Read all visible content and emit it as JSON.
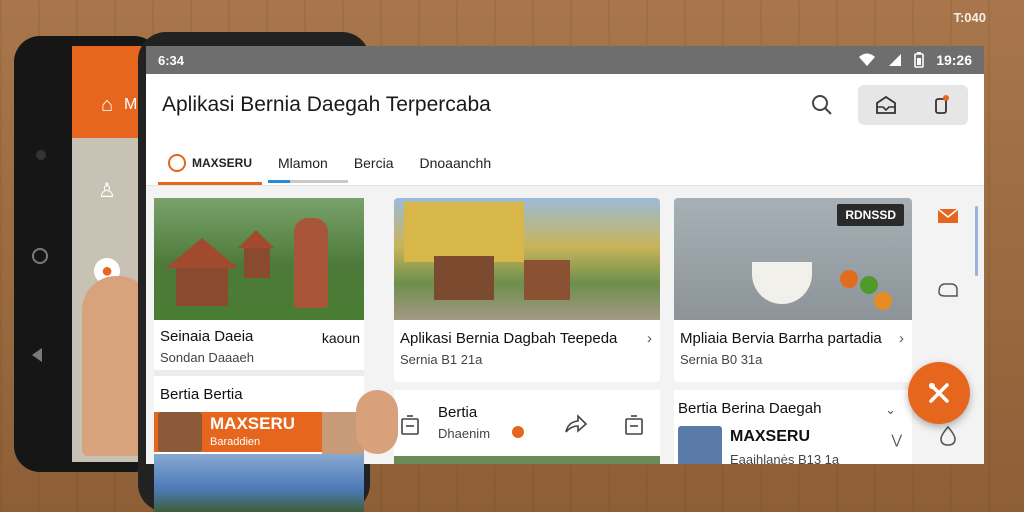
{
  "corner_stamp": "T:040",
  "status": {
    "left_text": "6:34",
    "time": "19:26"
  },
  "app": {
    "title": "Aplikasi Bernia Daegah Terpercaba"
  },
  "tabs": [
    {
      "label": "MAXSERU"
    },
    {
      "label": "Mlamon"
    },
    {
      "label": "Bercia"
    },
    {
      "label": "Dnoaanchh"
    }
  ],
  "back_phone": {
    "label": "M"
  },
  "cards": [
    {
      "title": "Seinaia Daeia",
      "aside": "kaoun",
      "sub": "Sondan Daaaeh"
    },
    {
      "title": "Aplikasi Bernia Dagbah Teepeda",
      "sub": "Sernia B1 21a"
    },
    {
      "title": "Mpliaia Bervia Barrha partadia",
      "sub": "Sernia B0 31a",
      "badge": "RDNSSD"
    }
  ],
  "row_cards": [
    {
      "title": "Bertia Bertia"
    },
    {
      "title": "Bertia",
      "sub": "Dhaenim"
    },
    {
      "title": "Bertia Berina Daegah",
      "brand": "MAXSERU",
      "sub": "Eaaihlanės B13 1a"
    }
  ],
  "promo": {
    "title": "MAXSERU",
    "sub": "Baraddien"
  },
  "colors": {
    "accent": "#e7661d",
    "link": "#2a8ad3"
  },
  "icons": [
    "home-icon",
    "search-icon",
    "inbox-icon",
    "bell-icon",
    "mail-icon",
    "hand-icon",
    "share-icon",
    "save-icon",
    "tools-icon",
    "wifi-icon",
    "battery-icon"
  ]
}
